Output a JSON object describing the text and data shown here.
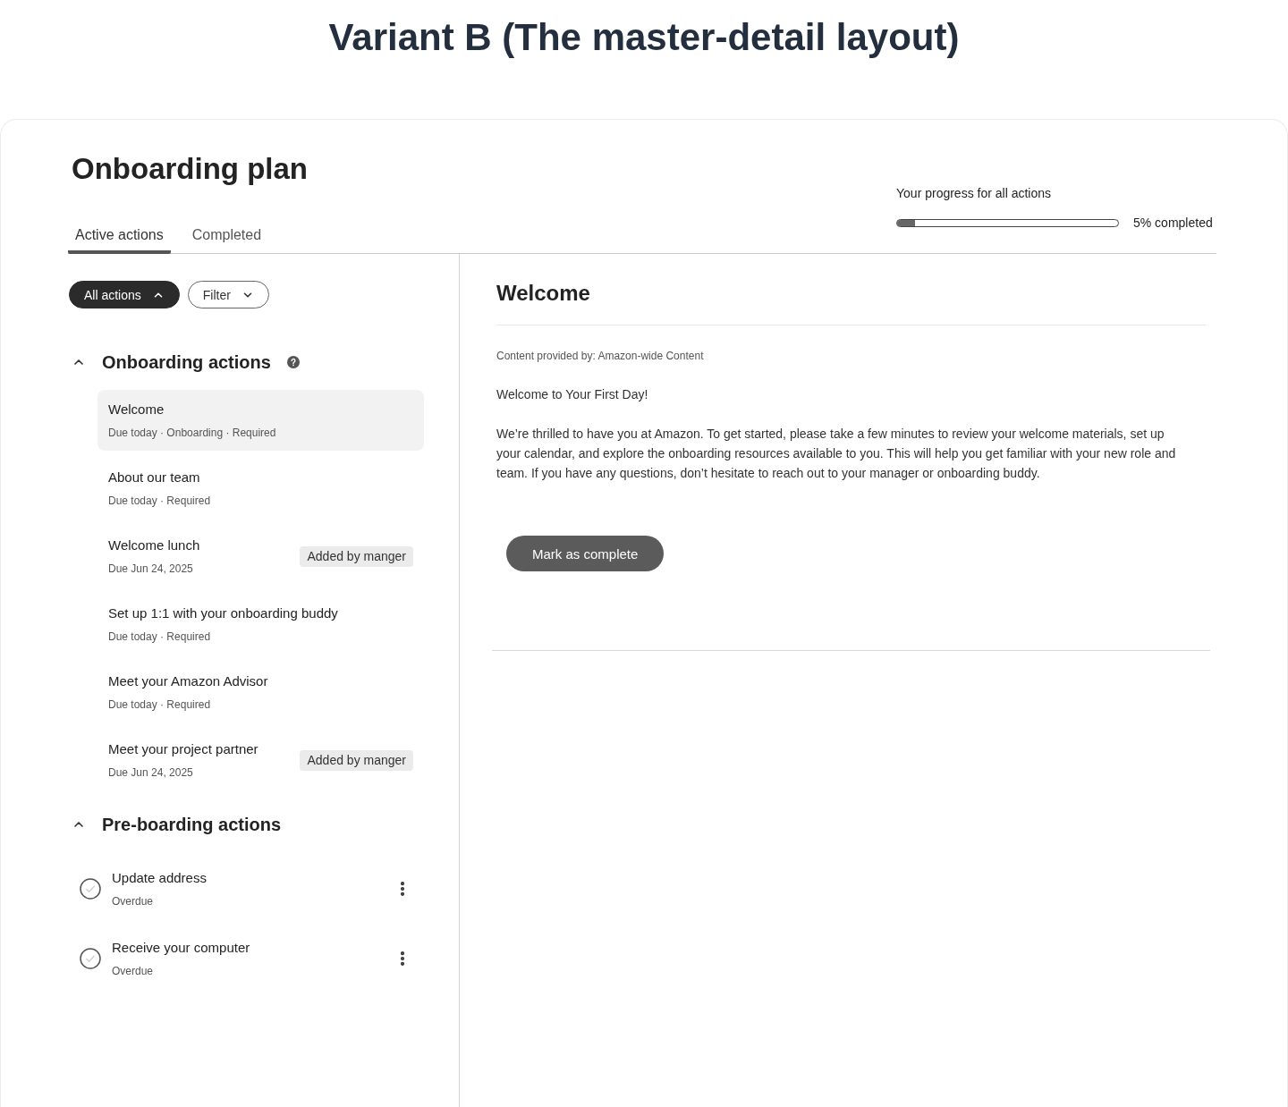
{
  "page_title": "Variant B (The master-detail layout)",
  "plan": {
    "title": "Onboarding plan",
    "tabs": [
      {
        "label": "Active actions",
        "selected": true
      },
      {
        "label": "Completed",
        "selected": false
      }
    ],
    "progress": {
      "label": "Your progress for all actions",
      "level": 0.08,
      "reading": "5% completed"
    }
  },
  "filters": [
    {
      "label": "All actions",
      "selected": true,
      "expanded": true
    },
    {
      "label": "Filter",
      "selected": false,
      "expanded": false
    }
  ],
  "sections": [
    {
      "title": "Onboarding actions",
      "expanded": true,
      "help": true,
      "items": [
        {
          "kind": "action",
          "title": "Welcome",
          "meta": "Due today · Onboarding · Required",
          "selected": true
        },
        {
          "kind": "action",
          "title": "About our team",
          "meta": "Due today · Required",
          "selected": false
        },
        {
          "kind": "action",
          "title": "Welcome lunch",
          "meta": "Due Jun 24, 2025",
          "badge": "Added by manger",
          "selected": false
        },
        {
          "kind": "action",
          "title": "Set up 1:1 with your onboarding buddy",
          "meta": "Due today · Required",
          "selected": false
        },
        {
          "kind": "action",
          "title": "Meet your Amazon Advisor",
          "meta": "Due today · Required",
          "selected": false
        },
        {
          "kind": "action",
          "title": "Meet your project partner",
          "meta": "Due Jun 24, 2025",
          "badge": "Added by manger",
          "selected": false
        }
      ]
    },
    {
      "title": "Pre-boarding actions",
      "expanded": true,
      "help": false,
      "items": [
        {
          "kind": "task",
          "title": "Update address",
          "meta": "Overdue",
          "checked": false,
          "selected": false
        },
        {
          "kind": "task",
          "title": "Receive your computer",
          "meta": "Overdue",
          "checked": false,
          "selected": false
        }
      ]
    }
  ],
  "detail": {
    "title": "Welcome",
    "source": "Content provided by: Amazon-wide Content",
    "greeting": "Welcome to Your First Day!",
    "body": "We’re thrilled to have you at Amazon. To get started, please take a few minutes to review your welcome materials, set up your calendar, and explore the onboarding resources available to you. This will help you get familiar with your new role and team. If you have any questions, don’t hesitate to reach out to your manager or onboarding buddy.",
    "button": {
      "label": "Mark as complete"
    }
  }
}
